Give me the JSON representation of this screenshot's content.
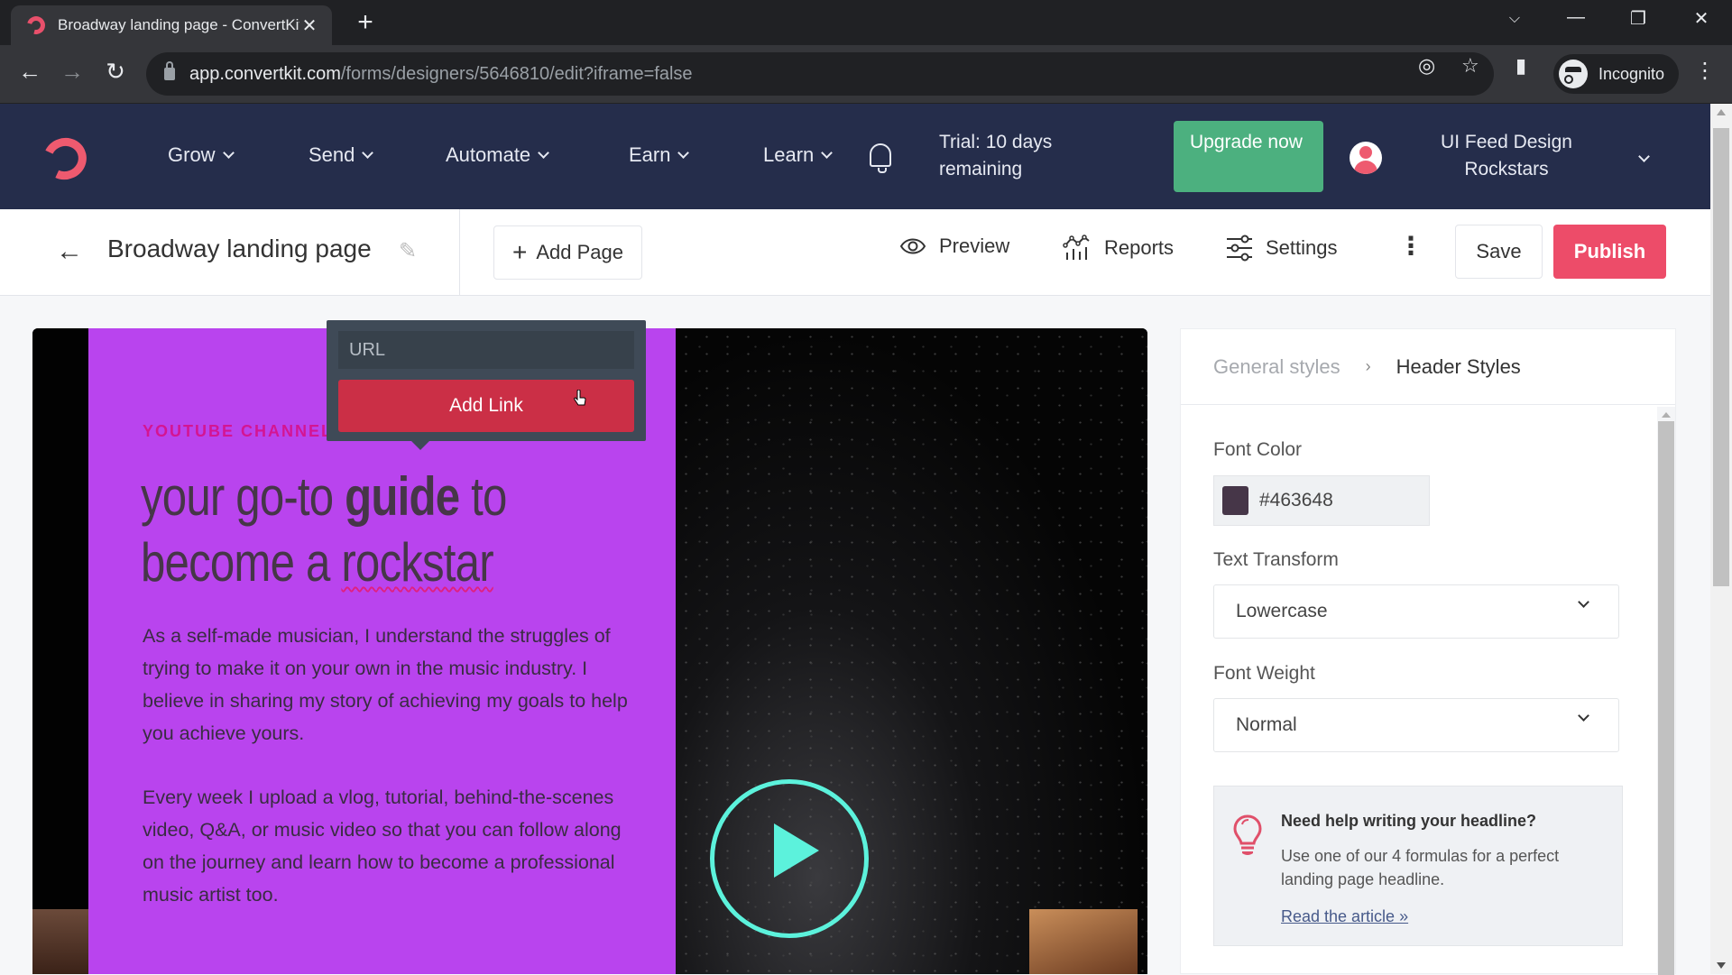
{
  "browser": {
    "tab_title": "Broadway landing page - ConvertKit",
    "url_host": "app.convertkit.com",
    "url_path": "/forms/designers/5646810/edit?iframe=false",
    "profile_label": "Incognito"
  },
  "appnav": {
    "items": [
      {
        "label": "Grow"
      },
      {
        "label": "Send"
      },
      {
        "label": "Automate"
      },
      {
        "label": "Earn"
      },
      {
        "label": "Learn"
      }
    ],
    "trial_text": "Trial: 10 days remaining",
    "upgrade_label": "Upgrade now",
    "account_name": "UI Feed Design Rockstars",
    "brand_color": "#ee5a6f",
    "nav_bg": "#252d4b"
  },
  "toolbar": {
    "page_title": "Broadway landing page",
    "add_page_label": "Add Page",
    "preview_label": "Preview",
    "reports_label": "Reports",
    "settings_label": "Settings",
    "save_label": "Save",
    "publish_label": "Publish"
  },
  "canvas": {
    "eyebrow": "YOUTUBE CHANNEL",
    "headline_parts": {
      "a": "your go-to ",
      "b": "guide",
      "c": " to become a ",
      "d": "rockstar"
    },
    "paragraph1": "As a self-made musician, I understand the struggles of trying to make it on your own in the music industry. I believe in sharing my story of achieving my goals to help you achieve yours.",
    "paragraph2": "Every week I upload a vlog, tutorial, behind-the-scenes video, Q&A, or music video so that you can follow along on the journey and learn how to become a professional music artist too.",
    "bg_color": "#b944ee",
    "play_color": "#5cf2dc"
  },
  "link_popover": {
    "url_placeholder": "URL",
    "url_value": "",
    "add_link_label": "Add Link"
  },
  "panel": {
    "breadcrumb_parent": "General styles",
    "breadcrumb_current": "Header Styles",
    "font_color_label": "Font Color",
    "font_color_value": "#463648",
    "text_transform_label": "Text Transform",
    "text_transform_value": "Lowercase",
    "font_weight_label": "Font Weight",
    "font_weight_value": "Normal",
    "help": {
      "title": "Need help writing your headline?",
      "text": "Use one of our 4 formulas for a perfect landing page headline.",
      "link": "Read the article »"
    }
  }
}
